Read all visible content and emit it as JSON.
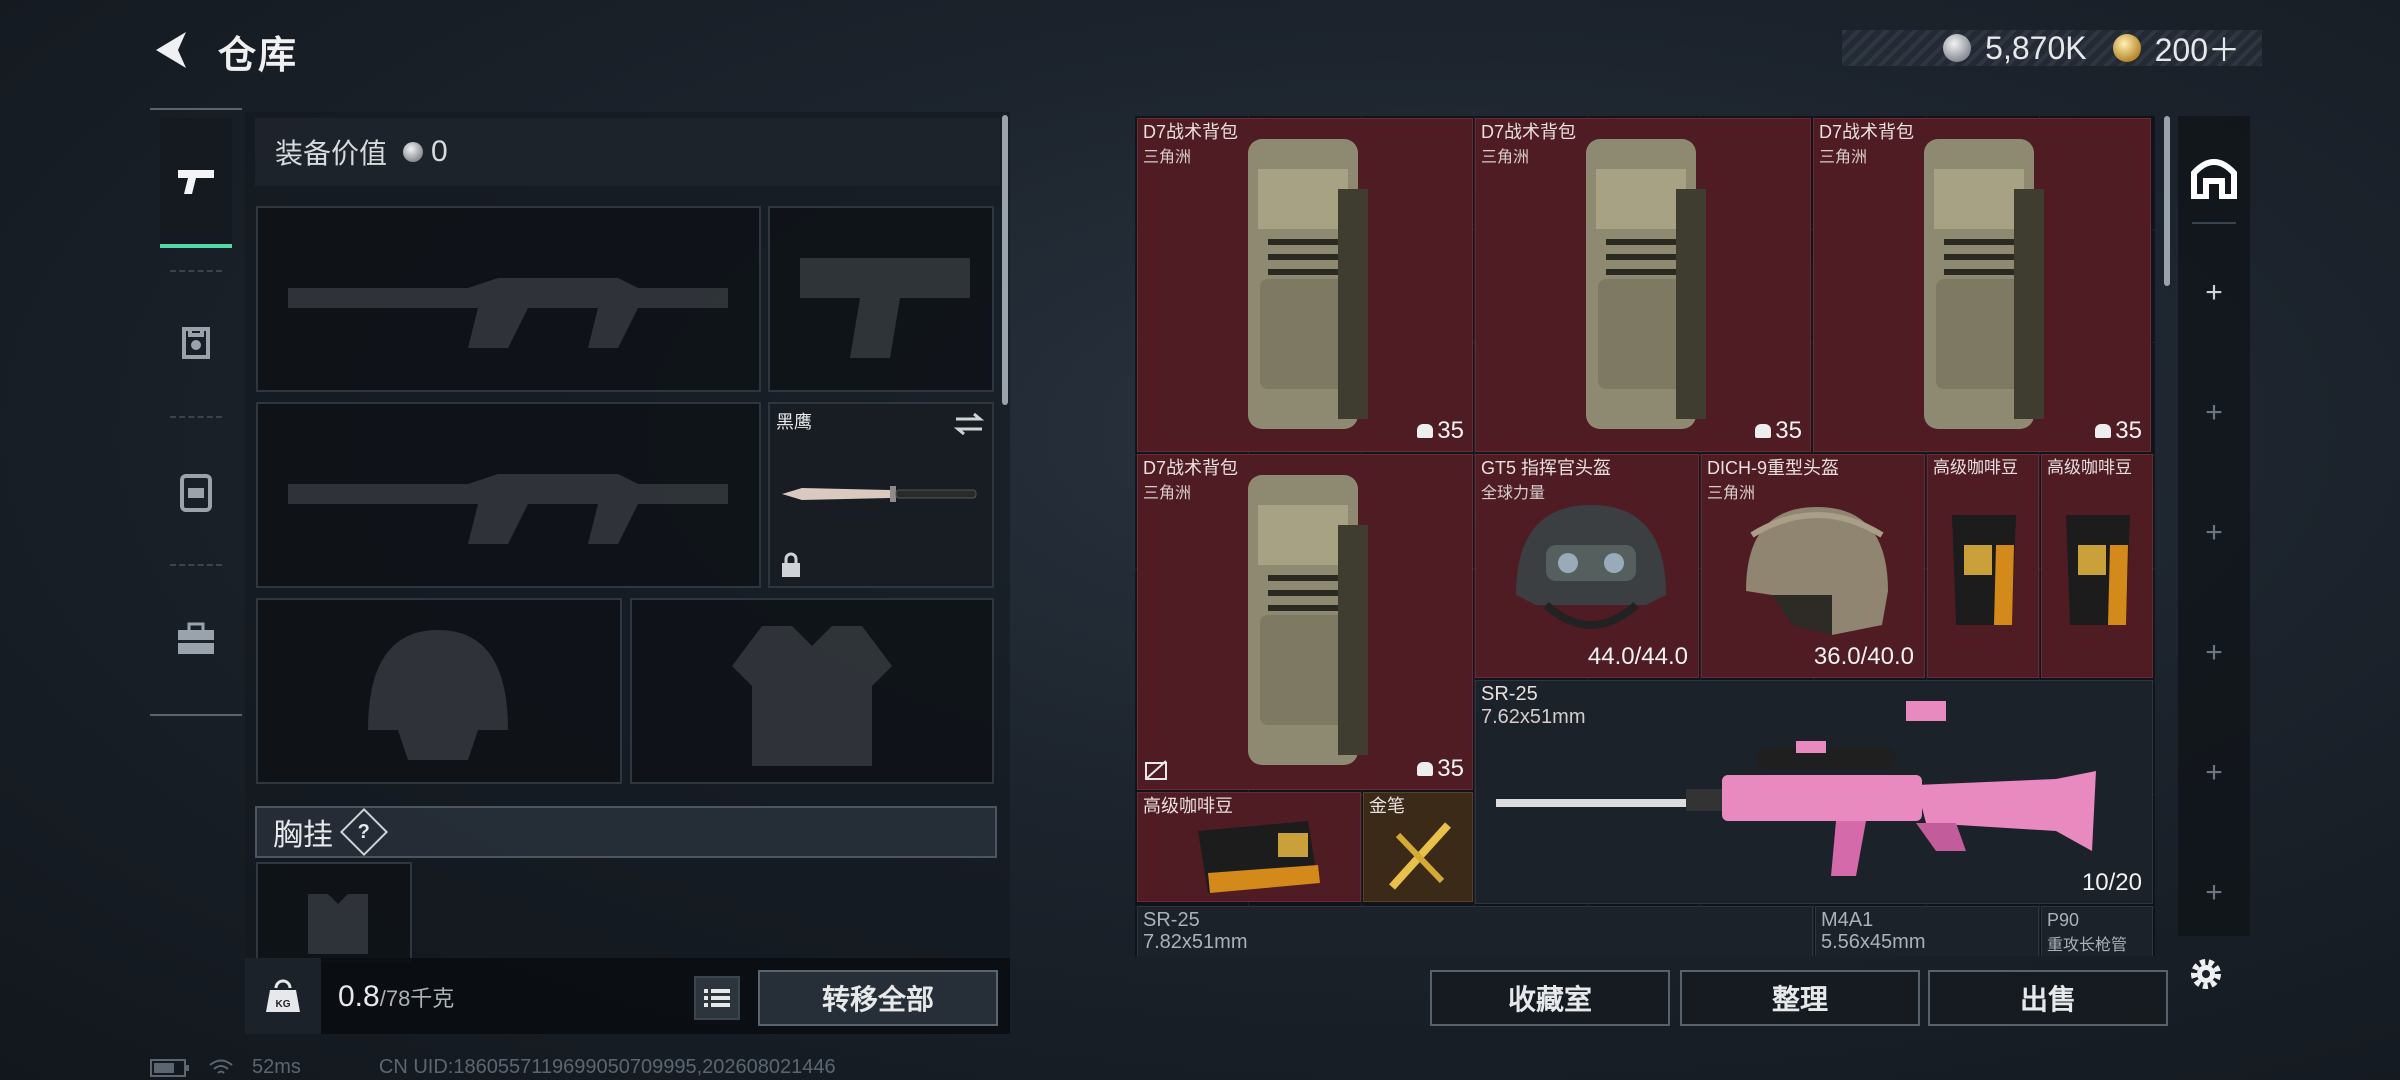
{
  "header": {
    "title": "仓库",
    "back_icon": "back-arrow-icon"
  },
  "currency": {
    "silver": "5,870K",
    "gold": "200＋"
  },
  "left_rail": {
    "tabs": [
      "pistol-icon",
      "armor-icon",
      "backpack-icon",
      "toolbox-icon"
    ],
    "active": 0
  },
  "loadout": {
    "equip_value_label": "装备价值",
    "equip_value": "0",
    "melee": {
      "name": "黑鹰"
    },
    "chest_rig_label": "胸挂",
    "chest_help": "?",
    "weight": "0.8",
    "weight_max": "/78千克",
    "transfer_all": "转移全部"
  },
  "stash": {
    "items": [
      {
        "name": "D7战术背包",
        "sub": "三角洲",
        "qty": "35"
      },
      {
        "name": "D7战术背包",
        "sub": "三角洲",
        "qty": "35"
      },
      {
        "name": "D7战术背包",
        "sub": "三角洲",
        "qty": "35"
      },
      {
        "name": "D7战术背包",
        "sub": "三角洲",
        "qty": "35"
      },
      {
        "name": "GT5 指挥官头盔",
        "sub": "全球力量",
        "durability": "44.0/44.0"
      },
      {
        "name": "DICH-9重型头盔",
        "sub": "三角洲",
        "durability": "36.0/40.0"
      },
      {
        "name": "高级咖啡豆"
      },
      {
        "name": "高级咖啡豆"
      },
      {
        "name": "SR-25",
        "sub": "7.62x51mm",
        "ammo": "10/20"
      },
      {
        "name": "高级咖啡豆"
      },
      {
        "name": "金笔"
      },
      {
        "name": "SR-25",
        "sub": "7.82x51mm"
      },
      {
        "name": "M4A1",
        "sub": "5.56x45mm"
      },
      {
        "name": "P90",
        "sub": "重攻长枪管"
      }
    ]
  },
  "actions": {
    "collection": "收藏室",
    "organize": "整理",
    "sell": "出售"
  },
  "status": {
    "ping": "52ms",
    "uid": "CN UID:1860557119699050709995,202608021446"
  },
  "colors": {
    "accent": "#55d6a7",
    "item_red": "#4f1c24",
    "item_gold": "#3c2a18"
  }
}
